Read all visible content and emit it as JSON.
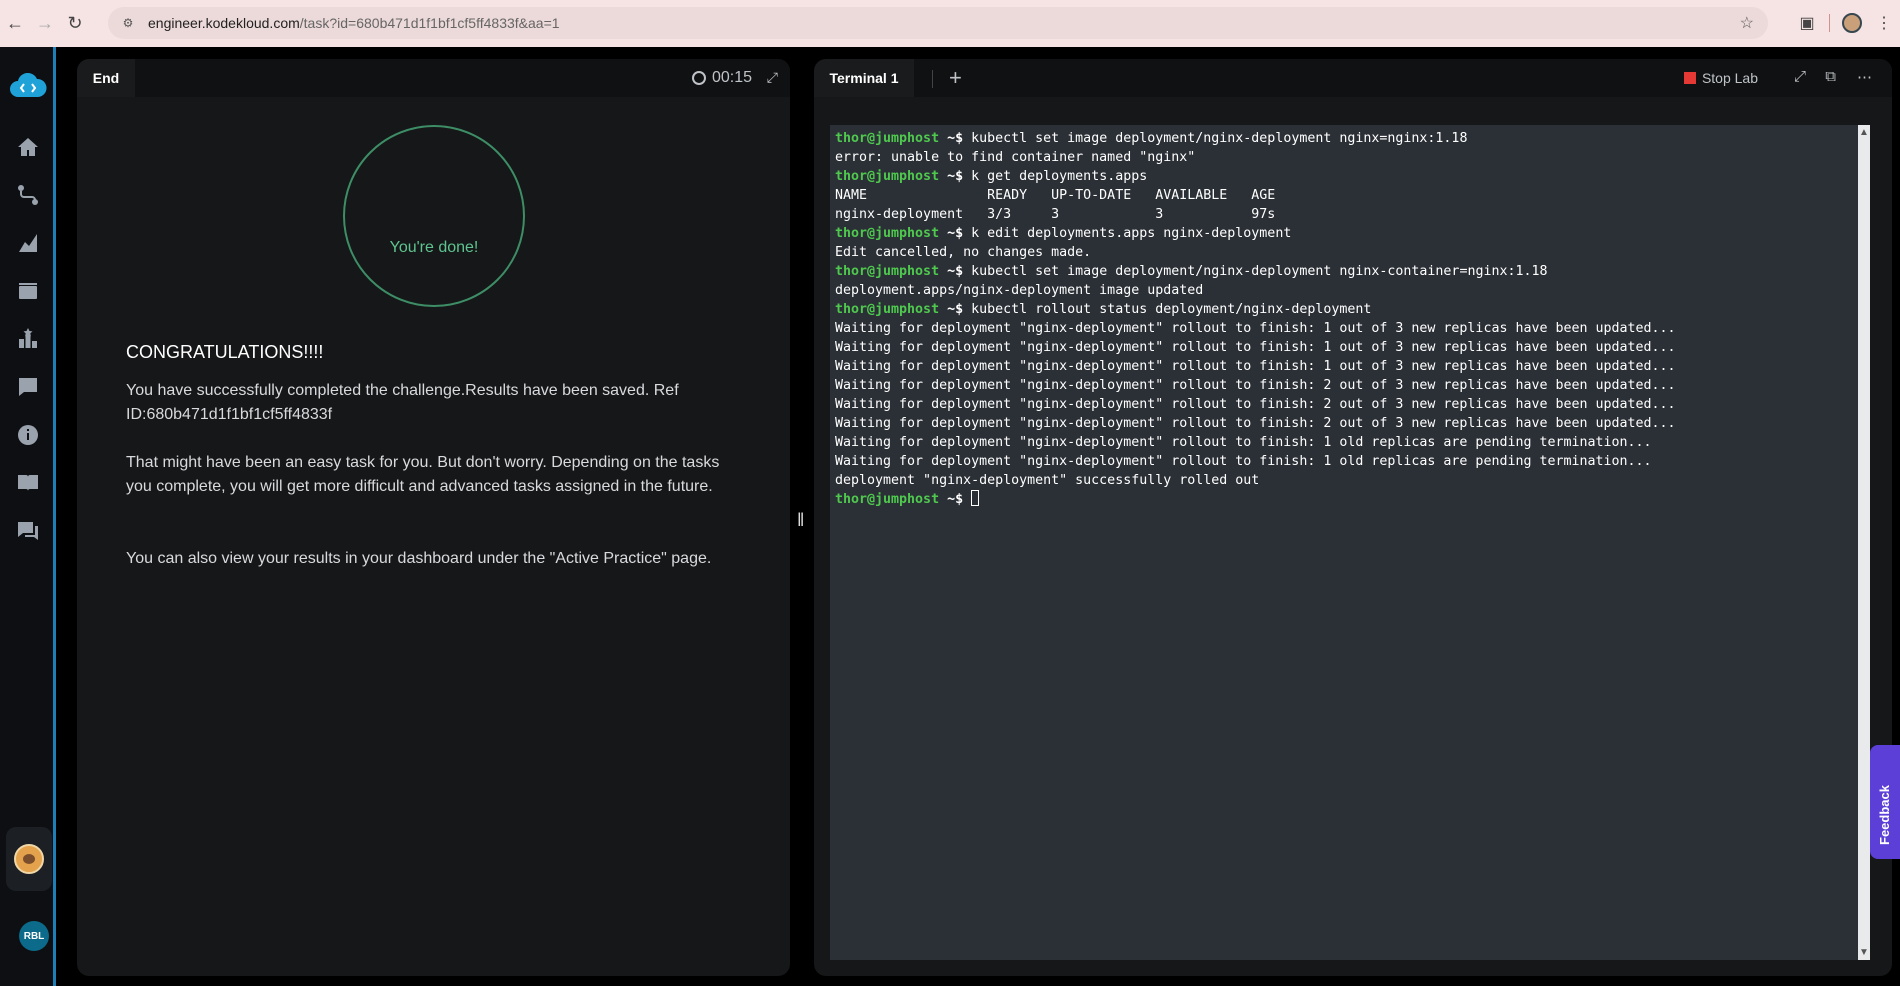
{
  "browser": {
    "url_host": "engineer.kodekloud.com",
    "url_path": "/task?id=680b471d1f1bf1cf5ff4833f&aa=1"
  },
  "sidebar": {
    "user_initials": "RBL"
  },
  "left_panel": {
    "tab_label": "End",
    "timer": "00:15",
    "done_text": "You're done!",
    "heading": "CONGRATULATIONS!!!!",
    "paragraphs": [
      "You have successfully completed the challenge.Results have been saved. Ref ID:680b471d1f1bf1cf5ff4833f",
      "That might have been an easy task for you. But don't worry. Depending on the tasks you complete, you will get more difficult and advanced tasks assigned in the future.",
      "You can also view your results in your dashboard under the \"Active Practice\" page."
    ]
  },
  "right_panel": {
    "tab_label": "Terminal 1",
    "stop_lab": "Stop Lab"
  },
  "terminal": {
    "prompt_user": "thor@jumphost",
    "prompt_suffix": " ~$ ",
    "lines": [
      {
        "type": "cmd",
        "text": "kubectl set image deployment/nginx-deployment nginx=nginx:1.18"
      },
      {
        "type": "out",
        "text": "error: unable to find container named \"nginx\""
      },
      {
        "type": "cmd",
        "text": "k get deployments.apps"
      },
      {
        "type": "out",
        "text": "NAME               READY   UP-TO-DATE   AVAILABLE   AGE"
      },
      {
        "type": "out",
        "text": "nginx-deployment   3/3     3            3           97s"
      },
      {
        "type": "cmd",
        "text": "k edit deployments.apps nginx-deployment"
      },
      {
        "type": "out",
        "text": "Edit cancelled, no changes made."
      },
      {
        "type": "cmd",
        "text": "kubectl set image deployment/nginx-deployment nginx-container=nginx:1.18"
      },
      {
        "type": "out",
        "text": "deployment.apps/nginx-deployment image updated"
      },
      {
        "type": "cmd",
        "text": "kubectl rollout status deployment/nginx-deployment"
      },
      {
        "type": "out",
        "text": "Waiting for deployment \"nginx-deployment\" rollout to finish: 1 out of 3 new replicas have been updated..."
      },
      {
        "type": "out",
        "text": "Waiting for deployment \"nginx-deployment\" rollout to finish: 1 out of 3 new replicas have been updated..."
      },
      {
        "type": "out",
        "text": "Waiting for deployment \"nginx-deployment\" rollout to finish: 1 out of 3 new replicas have been updated..."
      },
      {
        "type": "out",
        "text": "Waiting for deployment \"nginx-deployment\" rollout to finish: 2 out of 3 new replicas have been updated..."
      },
      {
        "type": "out",
        "text": "Waiting for deployment \"nginx-deployment\" rollout to finish: 2 out of 3 new replicas have been updated..."
      },
      {
        "type": "out",
        "text": "Waiting for deployment \"nginx-deployment\" rollout to finish: 2 out of 3 new replicas have been updated..."
      },
      {
        "type": "out",
        "text": "Waiting for deployment \"nginx-deployment\" rollout to finish: 1 old replicas are pending termination..."
      },
      {
        "type": "out",
        "text": "Waiting for deployment \"nginx-deployment\" rollout to finish: 1 old replicas are pending termination..."
      },
      {
        "type": "out",
        "text": "deployment \"nginx-deployment\" successfully rolled out"
      },
      {
        "type": "cmd",
        "text": ""
      }
    ]
  },
  "feedback_label": "Feedback",
  "colors": {
    "prompt_green": "#4ec94e",
    "done_green": "#5ec48f",
    "feedback_purple": "#5b3fd6",
    "sidebar_accent": "#1e7fb8"
  }
}
